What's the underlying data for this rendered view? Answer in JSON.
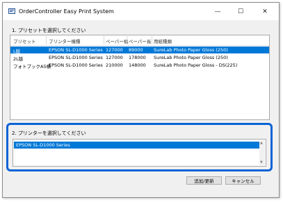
{
  "window": {
    "title": "OrderController Easy Print System",
    "controls": {
      "minimize": "—",
      "maximize": "☐",
      "close": "✕"
    }
  },
  "section1": {
    "label": "1. プリセットを選択してください"
  },
  "table": {
    "headers": [
      "プリセット",
      "プリンター機種",
      "ペーパー幅",
      "ペーパー長",
      "用紙種類"
    ],
    "rows": [
      [
        "L版",
        "EPSON SL-D1000 Series",
        "127000",
        "89000",
        "SureLab Photo Paper Gloss (250)"
      ],
      [
        "2L版",
        "EPSON SL-D1000 Series",
        "127000",
        "178000",
        "SureLab Photo Paper Gloss (250)"
      ],
      [
        "フォトブックA5横",
        "EPSON SL-D1000 Series",
        "210000",
        "148000",
        "SureLab Photo Paper Gloss - DS(225)"
      ]
    ],
    "selected_row": 0
  },
  "section2": {
    "label": "2. プリンターを選択してください"
  },
  "printers": {
    "items": [
      "EPSON SL-D1000 Series"
    ],
    "selected": 0
  },
  "buttons": {
    "update": "追加/更新",
    "cancel": "キャンセル"
  },
  "colors": {
    "selection": "#0078d7",
    "highlight_border": "#0b63d6"
  },
  "icons": {
    "app": "printer-app-icon",
    "scroll_up": "arrow-up-icon",
    "scroll_down": "arrow-down-icon"
  }
}
